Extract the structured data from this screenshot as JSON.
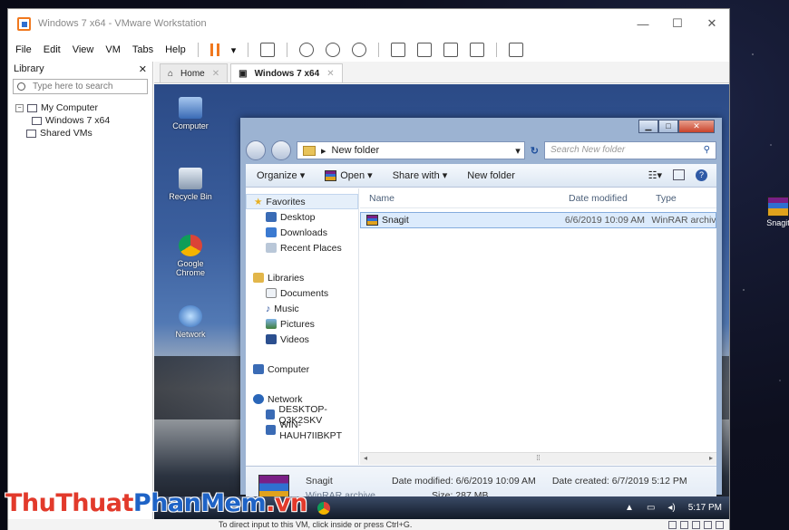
{
  "host": {
    "desktop_icon_label": "Snagit"
  },
  "vmware": {
    "window_title": "Windows 7 x64 - VMware Workstation",
    "menu": [
      "File",
      "Edit",
      "View",
      "VM",
      "Tabs",
      "Help"
    ],
    "library": {
      "title": "Library",
      "search_placeholder": "Type here to search",
      "tree": {
        "root": "My Computer",
        "child": "Windows 7 x64",
        "shared": "Shared VMs"
      }
    },
    "tabs": [
      {
        "label": "Home"
      },
      {
        "label": "Windows 7 x64"
      }
    ],
    "status_text": "To direct input to this VM, click inside or press Ctrl+G."
  },
  "guest": {
    "desktop_icons": [
      "Computer",
      "Recycle Bin",
      "Google Chrome",
      "Network"
    ],
    "taskbar_time": "5:17 PM",
    "explorer": {
      "address": "New folder",
      "search_placeholder": "Search New folder",
      "commands": {
        "organize": "Organize ▾",
        "open": "Open ▾",
        "share": "Share with ▾",
        "new_folder": "New folder"
      },
      "nav": {
        "favorites": "Favorites",
        "desktop": "Desktop",
        "downloads": "Downloads",
        "recent": "Recent Places",
        "libraries": "Libraries",
        "documents": "Documents",
        "music": "Music",
        "pictures": "Pictures",
        "videos": "Videos",
        "computer": "Computer",
        "network": "Network",
        "pc1": "DESKTOP-Q3K2SKV",
        "pc2": "WIN-HAUH7IIBKPT"
      },
      "columns": [
        "Name",
        "Date modified",
        "Type"
      ],
      "files": [
        {
          "name": "Snagit",
          "date": "6/6/2019 10:09 AM",
          "type": "WinRAR archive"
        }
      ],
      "details": {
        "name": "Snagit",
        "type": "WinRAR archive",
        "modified": "Date modified: 6/6/2019 10:09 AM",
        "size": "Size: 287 MB",
        "created": "Date created: 6/7/2019 5:12 PM"
      }
    }
  },
  "watermark": {
    "part1": "ThuThuat",
    "part2": "PhanMem",
    "part3": ".vn"
  }
}
